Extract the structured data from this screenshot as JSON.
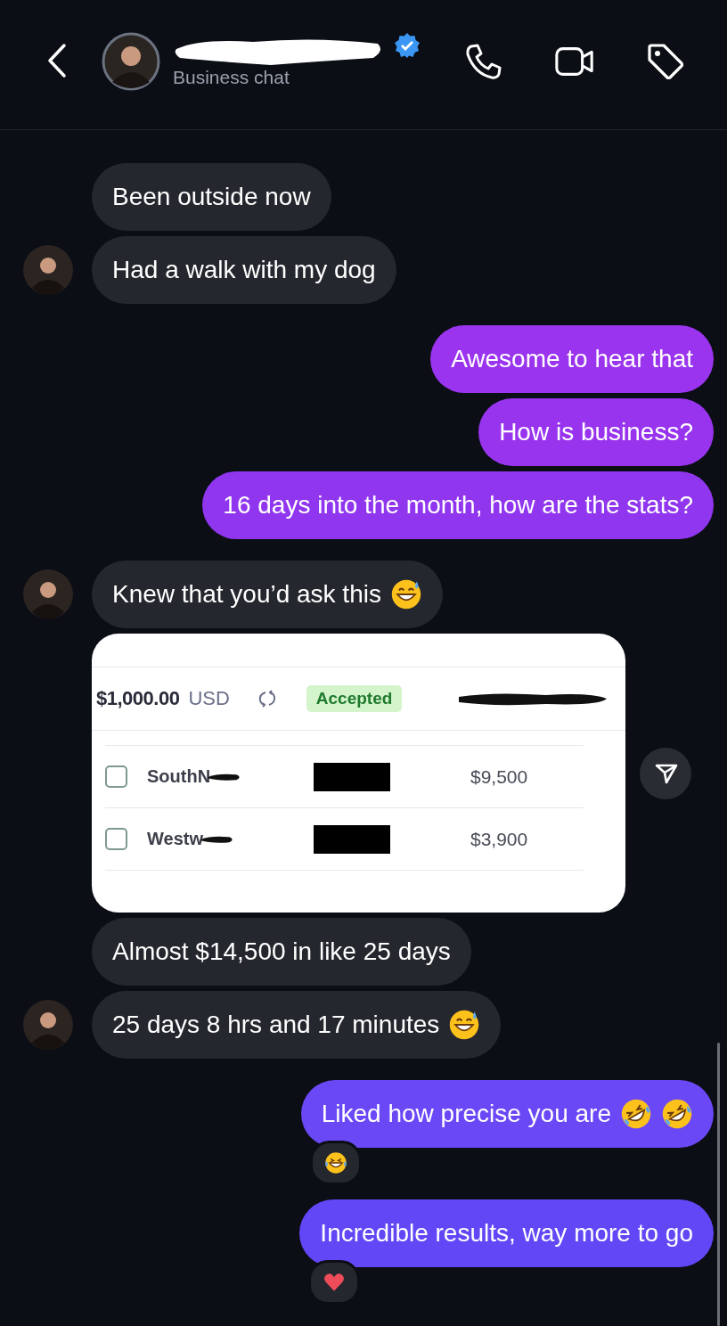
{
  "header": {
    "subtitle": "Business chat",
    "verified": true
  },
  "messages": [
    {
      "outgoing": false,
      "kind": "text",
      "avatar": false,
      "text": "Been outside now"
    },
    {
      "outgoing": false,
      "kind": "text",
      "avatar": true,
      "text": "Had a walk with my dog"
    },
    {
      "outgoing": true,
      "kind": "text",
      "color": "#9a34ee",
      "text": "Awesome to hear that"
    },
    {
      "outgoing": true,
      "kind": "text",
      "color": "#9834ee",
      "text": "How is business?"
    },
    {
      "outgoing": true,
      "kind": "text",
      "color": "#9036ef",
      "text": "16 days into the month, how are the stats?"
    },
    {
      "outgoing": false,
      "kind": "text",
      "avatar": true,
      "text": "Knew that you’d ask this",
      "emoji": [
        {
          "kind": "sweat-smile"
        }
      ]
    },
    {
      "outgoing": false,
      "kind": "payment_card",
      "avatar": false,
      "amount": "$1,000.00",
      "currency": "USD",
      "status": "Accepted",
      "rows": [
        {
          "name": "SouthN",
          "amount": "$9,500",
          "checked": false
        },
        {
          "name": "Westw",
          "amount": "$3,900",
          "checked": false
        }
      ]
    },
    {
      "outgoing": false,
      "kind": "text",
      "avatar": false,
      "text": "Almost $14,500 in like 25 days"
    },
    {
      "outgoing": false,
      "kind": "text",
      "avatar": true,
      "text": "25 days 8 hrs and 17 minutes",
      "emoji": [
        {
          "kind": "sweat-smile"
        }
      ]
    },
    {
      "outgoing": true,
      "kind": "text",
      "color": "#6a48f6",
      "text": "Liked how precise you are",
      "emoji": [
        {
          "kind": "rofl"
        },
        {
          "kind": "rofl"
        }
      ],
      "reaction": {
        "kind": "laugh-tears"
      }
    },
    {
      "outgoing": true,
      "kind": "text",
      "color": "#6147f6",
      "text": "Incredible results, way more to go",
      "reaction": {
        "kind": "heart"
      }
    }
  ]
}
